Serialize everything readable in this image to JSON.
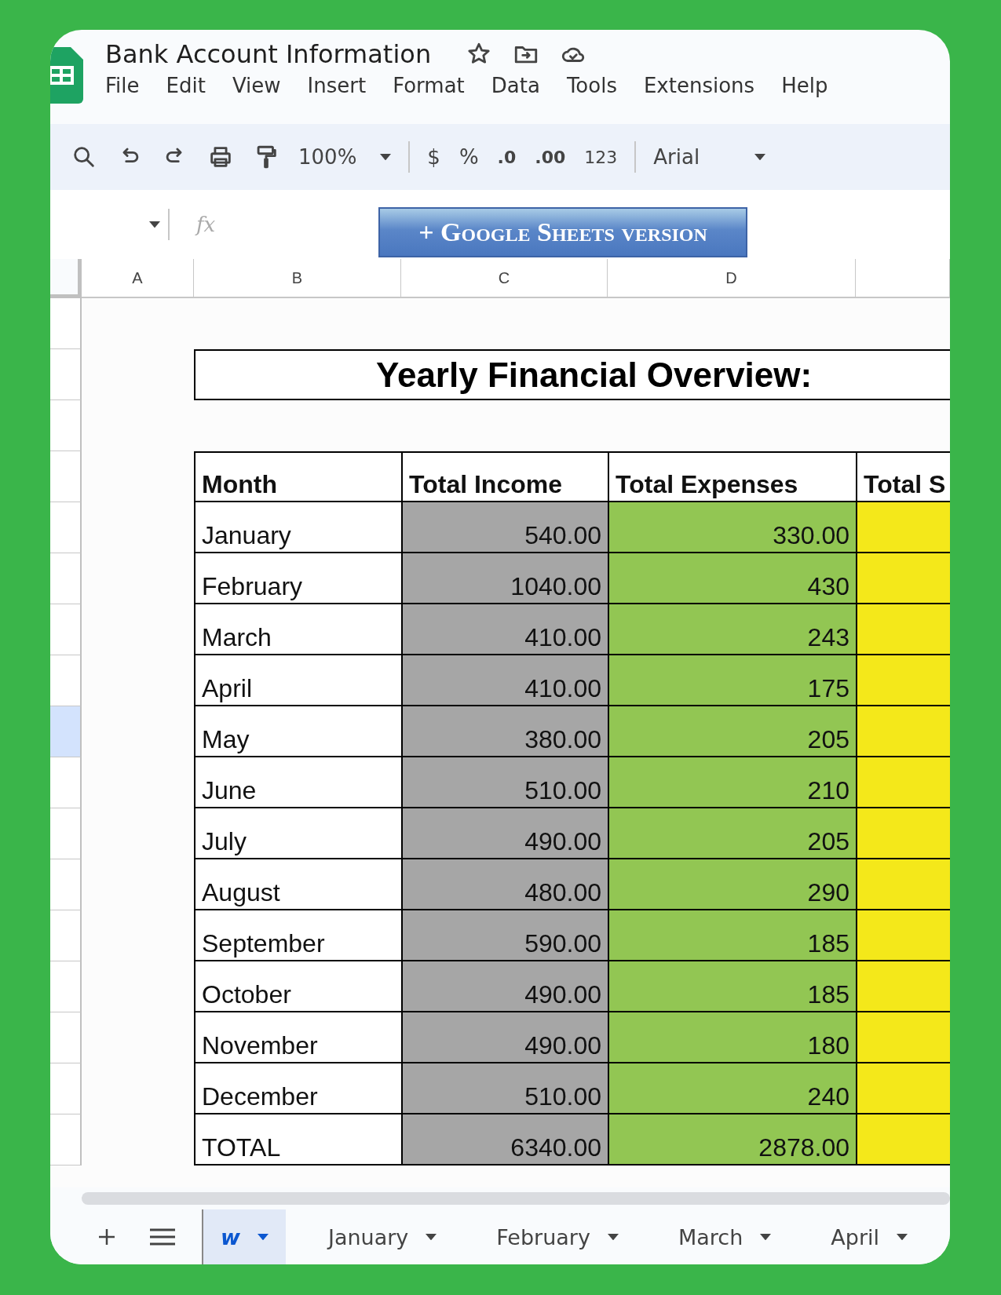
{
  "document": {
    "title": "Bank Account Information"
  },
  "menu": [
    "File",
    "Edit",
    "View",
    "Insert",
    "Format",
    "Data",
    "Tools",
    "Extensions",
    "Help"
  ],
  "toolbar": {
    "zoom": "100%",
    "currency": "$",
    "percent": "%",
    "decrease_decimal": ".0",
    "increase_decimal": ".00",
    "number_format": "123",
    "font": "Arial"
  },
  "formula_bar": {
    "fx": "fx"
  },
  "banner": {
    "text": "+ Google Sheets version"
  },
  "columns": [
    "A",
    "B",
    "C",
    "D"
  ],
  "row_headers": [
    {
      "selected": false
    },
    {
      "selected": false
    },
    {
      "selected": false
    },
    {
      "selected": false
    },
    {
      "selected": false
    },
    {
      "selected": false
    },
    {
      "selected": false
    },
    {
      "selected": false
    },
    {
      "selected": true
    },
    {
      "selected": false
    },
    {
      "selected": false
    },
    {
      "selected": false
    },
    {
      "selected": false
    },
    {
      "selected": false
    },
    {
      "selected": false
    },
    {
      "selected": false
    },
    {
      "selected": false
    }
  ],
  "sheet": {
    "title": "Yearly Financial Overview:",
    "headers": [
      "Month",
      "Total Income",
      "Total Expenses",
      "Total S"
    ],
    "rows": [
      {
        "month": "January",
        "income": "540.00",
        "expenses": "330.00"
      },
      {
        "month": "February",
        "income": "1040.00",
        "expenses": "430"
      },
      {
        "month": "March",
        "income": "410.00",
        "expenses": "243"
      },
      {
        "month": "April",
        "income": "410.00",
        "expenses": "175"
      },
      {
        "month": "May",
        "income": "380.00",
        "expenses": "205"
      },
      {
        "month": "June",
        "income": "510.00",
        "expenses": "210"
      },
      {
        "month": "July",
        "income": "490.00",
        "expenses": "205"
      },
      {
        "month": "August",
        "income": "480.00",
        "expenses": "290"
      },
      {
        "month": "September",
        "income": "590.00",
        "expenses": "185"
      },
      {
        "month": "October",
        "income": "490.00",
        "expenses": "185"
      },
      {
        "month": "November",
        "income": "490.00",
        "expenses": "180"
      },
      {
        "month": "December",
        "income": "510.00",
        "expenses": "240"
      },
      {
        "month": "TOTAL",
        "income": "6340.00",
        "expenses": "2878.00"
      }
    ]
  },
  "tabs": [
    {
      "label": "w",
      "selected": true
    },
    {
      "label": "January",
      "selected": false
    },
    {
      "label": "February",
      "selected": false
    },
    {
      "label": "March",
      "selected": false
    },
    {
      "label": "April",
      "selected": false
    }
  ]
}
